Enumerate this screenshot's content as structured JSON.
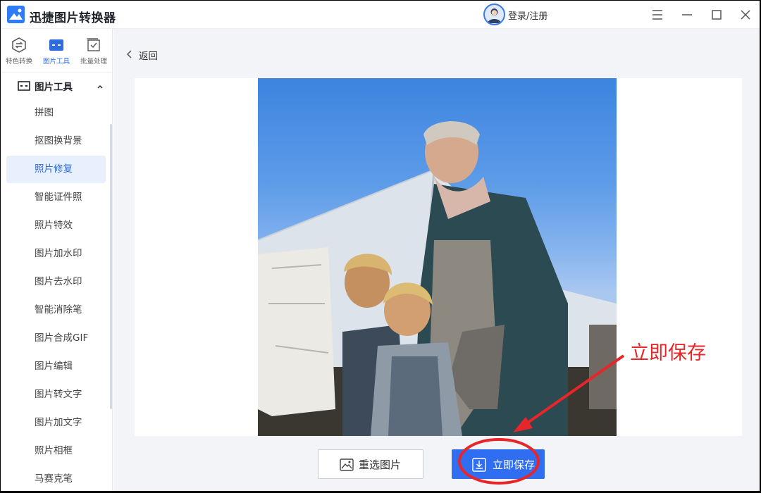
{
  "app": {
    "title": "迅捷图片转换器",
    "login_label": "登录/注册"
  },
  "window_controls": [
    "menu-icon",
    "minimize-icon",
    "maximize-icon",
    "close-icon"
  ],
  "sidebar": {
    "category_tabs": [
      {
        "label": "特色转换",
        "icon": "convert-icon",
        "active": false
      },
      {
        "label": "图片工具",
        "icon": "image-tool-icon",
        "active": true
      },
      {
        "label": "批量处理",
        "icon": "batch-icon",
        "active": false
      }
    ],
    "group": {
      "label": "图片工具",
      "expanded": true
    },
    "items": [
      {
        "label": "拼图",
        "active": false
      },
      {
        "label": "抠图换背景",
        "active": false
      },
      {
        "label": "照片修复",
        "active": true
      },
      {
        "label": "智能证件照",
        "active": false
      },
      {
        "label": "照片特效",
        "active": false
      },
      {
        "label": "图片加水印",
        "active": false
      },
      {
        "label": "图片去水印",
        "active": false
      },
      {
        "label": "智能消除笔",
        "active": false
      },
      {
        "label": "图片合成GIF",
        "active": false
      },
      {
        "label": "图片编辑",
        "active": false
      },
      {
        "label": "图片转文字",
        "active": false
      },
      {
        "label": "图片加文字",
        "active": false
      },
      {
        "label": "照片相框",
        "active": false
      },
      {
        "label": "马赛克笔",
        "active": false
      }
    ]
  },
  "main": {
    "back_label": "返回",
    "reselect_label": "重选图片",
    "save_label": "立即保存"
  },
  "annotation": {
    "text": "立即保存",
    "color": "#e8262a"
  },
  "colors": {
    "accent": "#2f6ef0",
    "active_bg": "#e8f0fd"
  }
}
